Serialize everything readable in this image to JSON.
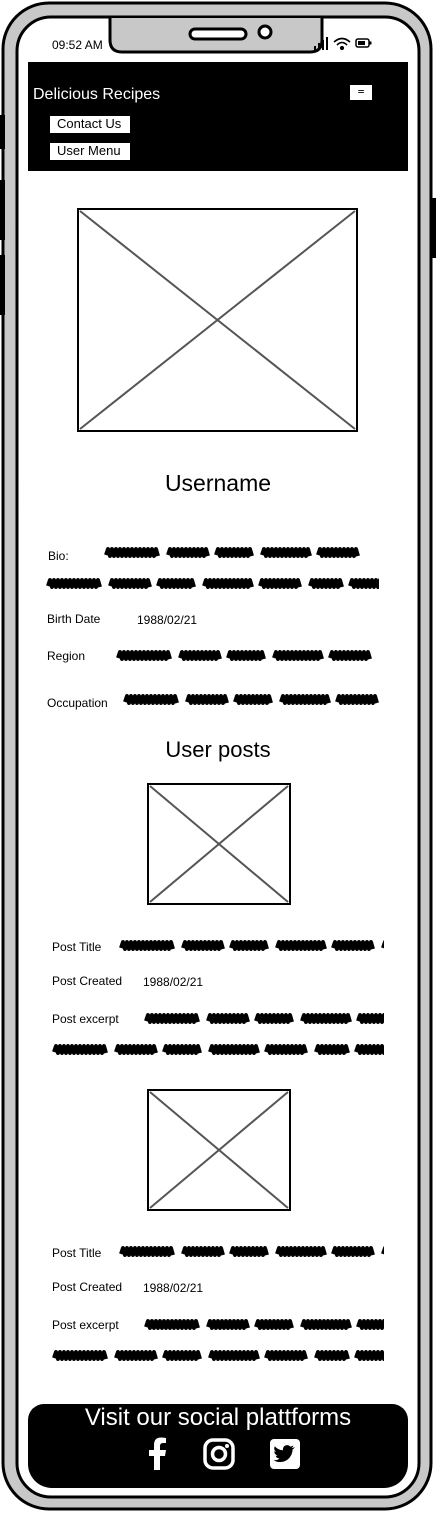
{
  "status_bar": {
    "time": "09:52 AM"
  },
  "header": {
    "title": "Delicious Recipes",
    "menu_icon": "hamburger-menu-icon",
    "nav": {
      "contact_label": "Contact Us",
      "user_menu_label": "User Menu"
    }
  },
  "profile": {
    "username": "Username",
    "bio_label": "Bio:",
    "birth_date_label": "Birth Date",
    "birth_date_value": "1988/02/21",
    "region_label": "Region",
    "occupation_label": "Occupation"
  },
  "posts_section": {
    "title": "User posts",
    "posts": [
      {
        "title_label": "Post Title",
        "created_label": "Post Created",
        "created_value": "1988/02/21",
        "excerpt_label": "Post excerpt"
      },
      {
        "title_label": "Post Title",
        "created_label": "Post Created",
        "created_value": "1988/02/21",
        "excerpt_label": "Post excerpt"
      }
    ]
  },
  "footer": {
    "title": "Visit our social plattforms",
    "icons": [
      "facebook-icon",
      "instagram-icon",
      "twitter-icon"
    ]
  },
  "colors": {
    "frame": "#000000",
    "frame_fill": "#c8c8c8",
    "header_bg": "#000000",
    "placeholder_line": "#555555"
  }
}
